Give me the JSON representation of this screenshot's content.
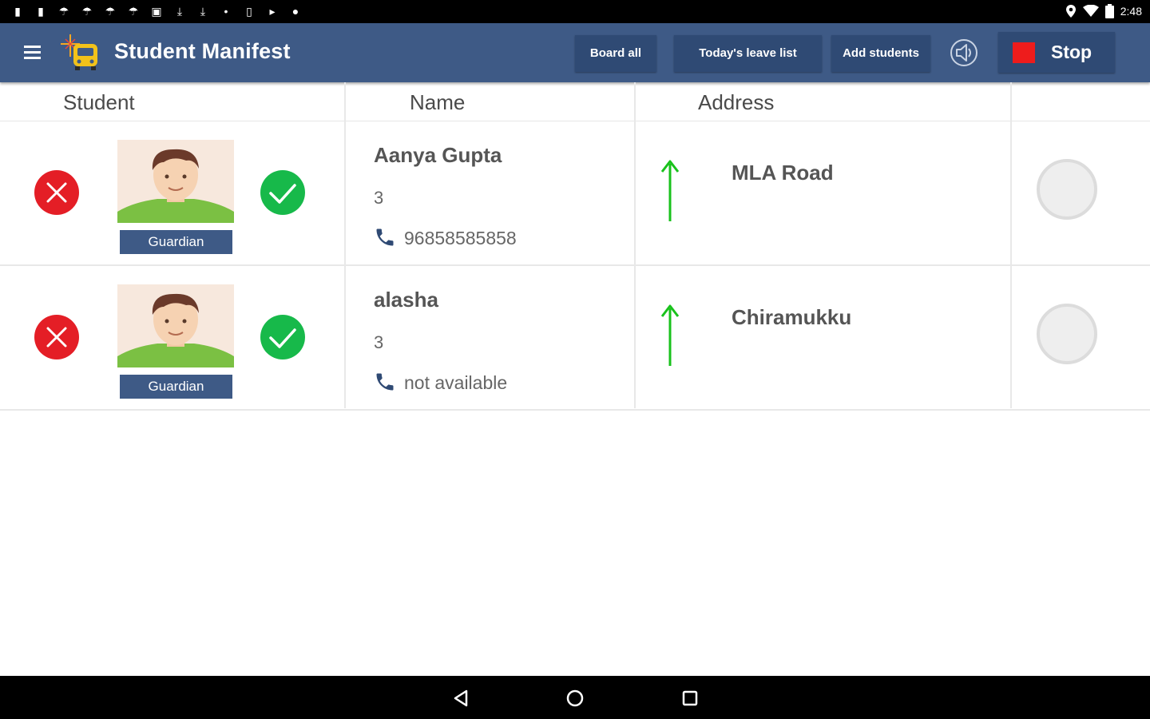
{
  "status_bar": {
    "time": "2:48"
  },
  "app_bar": {
    "title": "Student Manifest",
    "buttons": {
      "board_all": "Board all",
      "todays_leave_list": "Today's leave list",
      "add_students": "Add students",
      "stop": "Stop"
    }
  },
  "table": {
    "headers": {
      "student": "Student",
      "name": "Name",
      "address": "Address"
    },
    "rows": [
      {
        "guardian_label": "Guardian",
        "name": "Aanya Gupta",
        "grade": "3",
        "phone": "96858585858",
        "address": "MLA Road"
      },
      {
        "guardian_label": "Guardian",
        "name": "alasha",
        "grade": "3",
        "phone": "not available",
        "address": "Chiramukku"
      }
    ]
  },
  "colors": {
    "app_bar": "#3e5a86",
    "button_dark": "#2f4a74",
    "reject": "#e41e26",
    "accept": "#17b94a",
    "stop_square": "#ee1c1c",
    "arrow": "#19c21c"
  },
  "icons": [
    "menu-icon",
    "bus-logo-icon",
    "speaker-icon",
    "stop-icon",
    "close-icon",
    "check-icon",
    "phone-icon",
    "arrow-up-icon",
    "back-icon",
    "home-icon",
    "recents-icon"
  ]
}
